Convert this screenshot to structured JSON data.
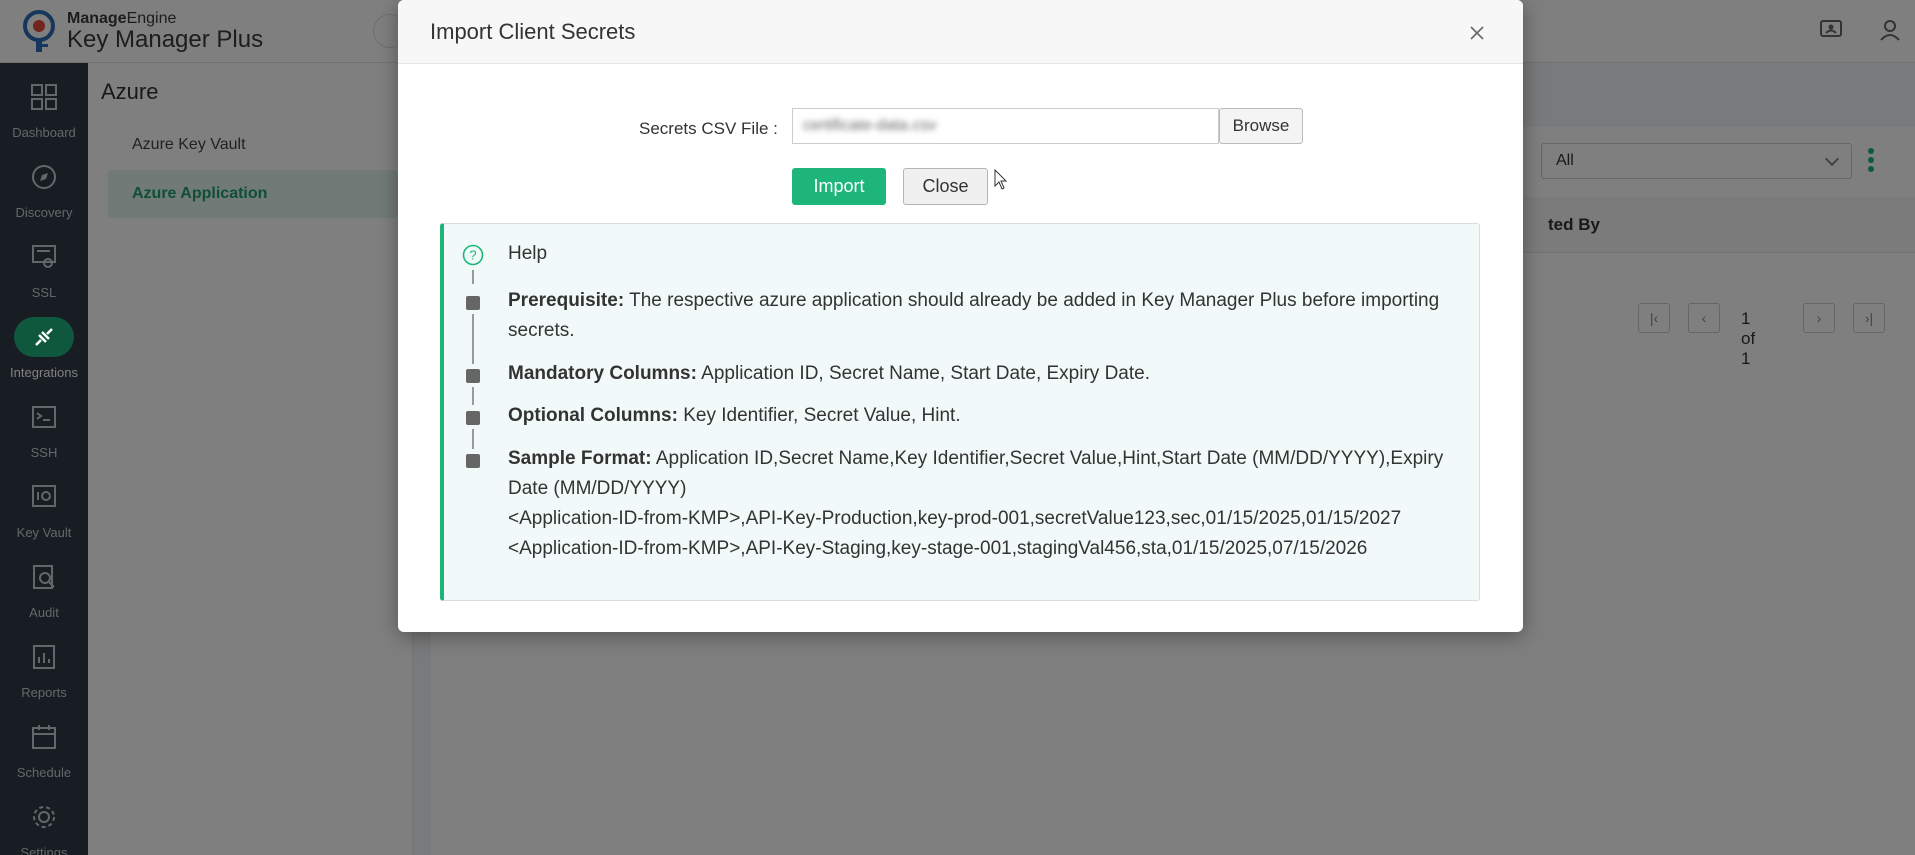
{
  "header": {
    "brand_prefix": "Manage",
    "brand_suffix": "Engine",
    "product_name": "Key Manager Plus"
  },
  "rail": {
    "items": [
      {
        "label": "Dashboard",
        "icon": "dashboard-icon"
      },
      {
        "label": "Discovery",
        "icon": "compass-icon"
      },
      {
        "label": "SSL",
        "icon": "certificate-icon"
      },
      {
        "label": "Integrations",
        "icon": "plug-icon",
        "active": true
      },
      {
        "label": "SSH",
        "icon": "terminal-icon"
      },
      {
        "label": "Key Vault",
        "icon": "vault-icon"
      },
      {
        "label": "Audit",
        "icon": "audit-icon"
      },
      {
        "label": "Reports",
        "icon": "reports-icon"
      },
      {
        "label": "Schedule",
        "icon": "calendar-icon"
      },
      {
        "label": "Settings",
        "icon": "gear-icon"
      }
    ]
  },
  "subnav": {
    "title": "Azure",
    "items": [
      {
        "label": "Azure Key Vault"
      },
      {
        "label": "Azure Application",
        "active": true
      }
    ]
  },
  "main": {
    "filter_value": "All",
    "column_partial": "ted By",
    "pagination": "1 of 1"
  },
  "modal": {
    "title": "Import Client Secrets",
    "file_label": "Secrets CSV File :",
    "file_value": "certificate-data.csv",
    "browse_label": "Browse",
    "import_label": "Import",
    "close_label": "Close",
    "help": {
      "title": "Help",
      "items": [
        {
          "heading": "Prerequisite:",
          "text": " The respective azure application should already be added in Key Manager Plus before importing secrets."
        },
        {
          "heading": "Mandatory Columns:",
          "text": " Application ID, Secret Name, Start Date, Expiry Date."
        },
        {
          "heading": "Optional Columns:",
          "text": " Key Identifier, Secret Value, Hint."
        },
        {
          "heading": "Sample Format:",
          "text": " Application ID,Secret Name,Key Identifier,Secret Value,Hint,Start Date (MM/DD/YYYY),Expiry Date (MM/DD/YYYY)"
        }
      ],
      "sample_lines": [
        "<Application-ID-from-KMP>,API-Key-Production,key-prod-001,secretValue123,sec,01/15/2025,01/15/2027",
        "<Application-ID-from-KMP>,API-Key-Staging,key-stage-001,stagingVal456,sta,01/15/2025,07/15/2026"
      ]
    }
  },
  "colors": {
    "accent": "#1db57a",
    "rail_bg": "#2f3a46",
    "help_bg": "#f1faf8"
  }
}
